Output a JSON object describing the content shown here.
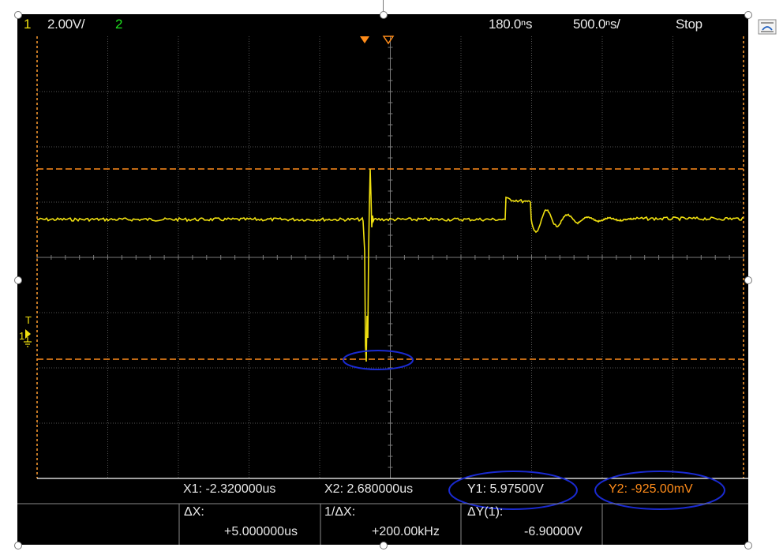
{
  "header": {
    "ch1_num": "1",
    "ch1_scale": "2.00V/",
    "ch2_num": "2",
    "time_delay": "180.0ⁿs",
    "time_scale": "500.0ⁿs/",
    "run_state": "Stop"
  },
  "trigger": {
    "label": "T",
    "ground_label": "1"
  },
  "measurements": {
    "x1": "X1: -2.320000us",
    "x2": "X2: 2.680000us",
    "y1": "Y1: 5.97500V",
    "y2": "Y2: -925.00mV",
    "dx_label": "ΔX:",
    "dx_value": "+5.000000us",
    "inv_dx_label": "1/ΔX:",
    "inv_dx_value": "+200.00kHz",
    "dy_label": "ΔY(1):",
    "dy_value": "-6.90000V"
  },
  "colors": {
    "ch1": "#f0e010",
    "ch2": "#1ee01e",
    "cursor": "#ff8c1a",
    "grid": "#5a5a5a",
    "annotation": "#1a2ad0"
  },
  "icons": {
    "layout_options": "wrap-text-icon"
  }
}
